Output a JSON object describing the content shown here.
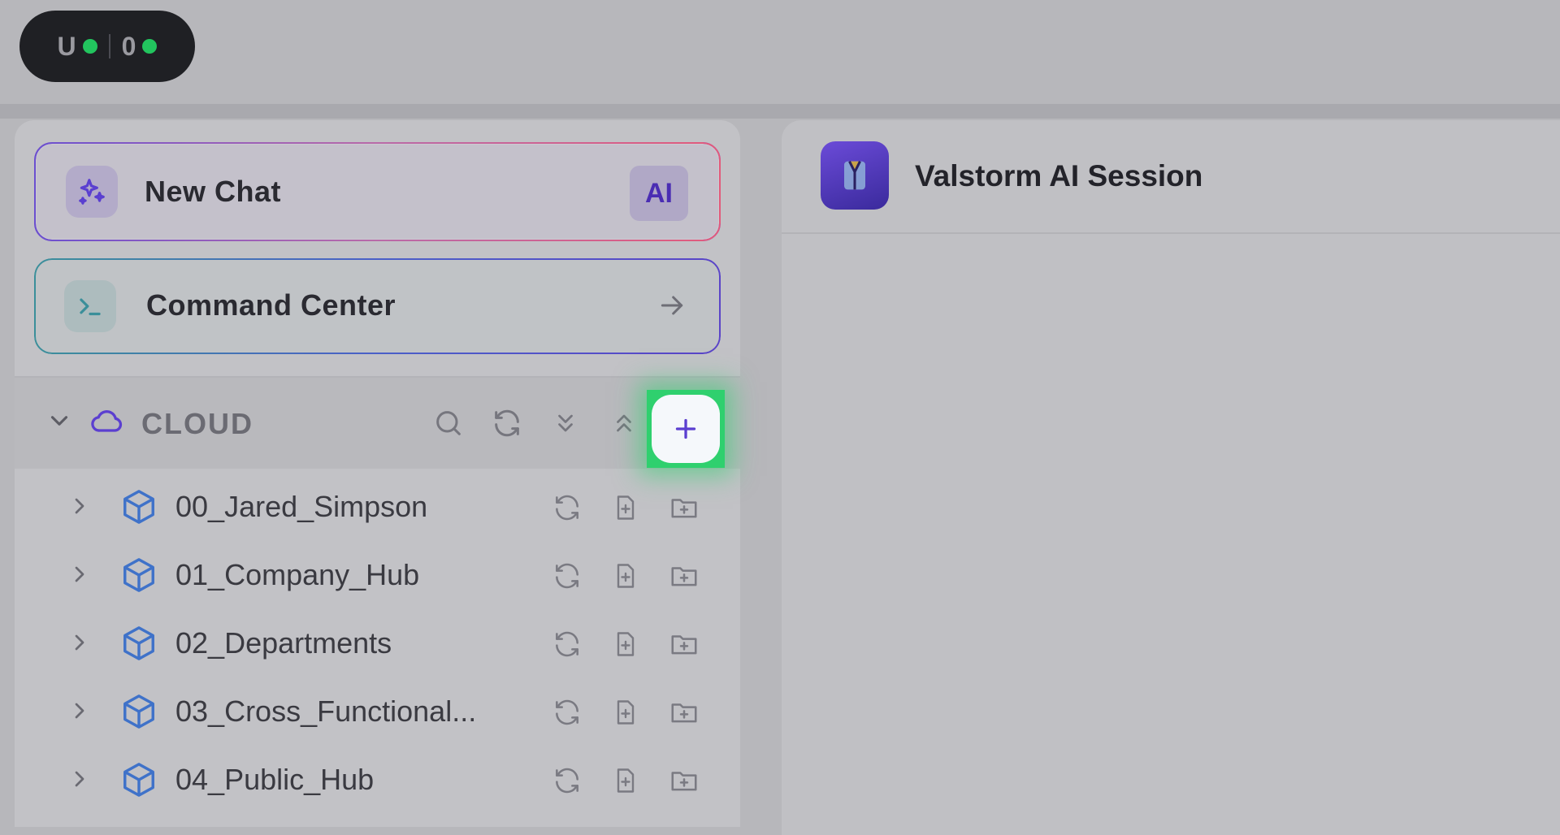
{
  "status_pill": {
    "left_label": "U",
    "right_label": "0",
    "status_color": "#22c55e"
  },
  "sidebar": {
    "new_chat": {
      "label": "New Chat",
      "badge": "AI",
      "icon": "sparkles-icon"
    },
    "command_center": {
      "label": "Command Center",
      "icon": "terminal-icon",
      "action_icon": "arrow-right-icon"
    },
    "cloud_section": {
      "title": "CLOUD",
      "icons": [
        "chevron-down-icon",
        "cloud-icon",
        "search-icon",
        "refresh-icon",
        "collapse-down-icon",
        "expand-up-icon",
        "plus-icon"
      ],
      "items": [
        {
          "label": "00_Jared_Simpson"
        },
        {
          "label": "01_Company_Hub"
        },
        {
          "label": "02_Departments"
        },
        {
          "label": "03_Cross_Functional..."
        },
        {
          "label": "04_Public_Hub"
        }
      ]
    }
  },
  "main": {
    "session_title": "Valstorm AI Session",
    "logo_icon": "valstorm-logo-icon"
  },
  "colors": {
    "accent_purple": "#5b3fd0",
    "highlight_green": "#2fd06e",
    "cube_blue": "#3f72c9"
  }
}
